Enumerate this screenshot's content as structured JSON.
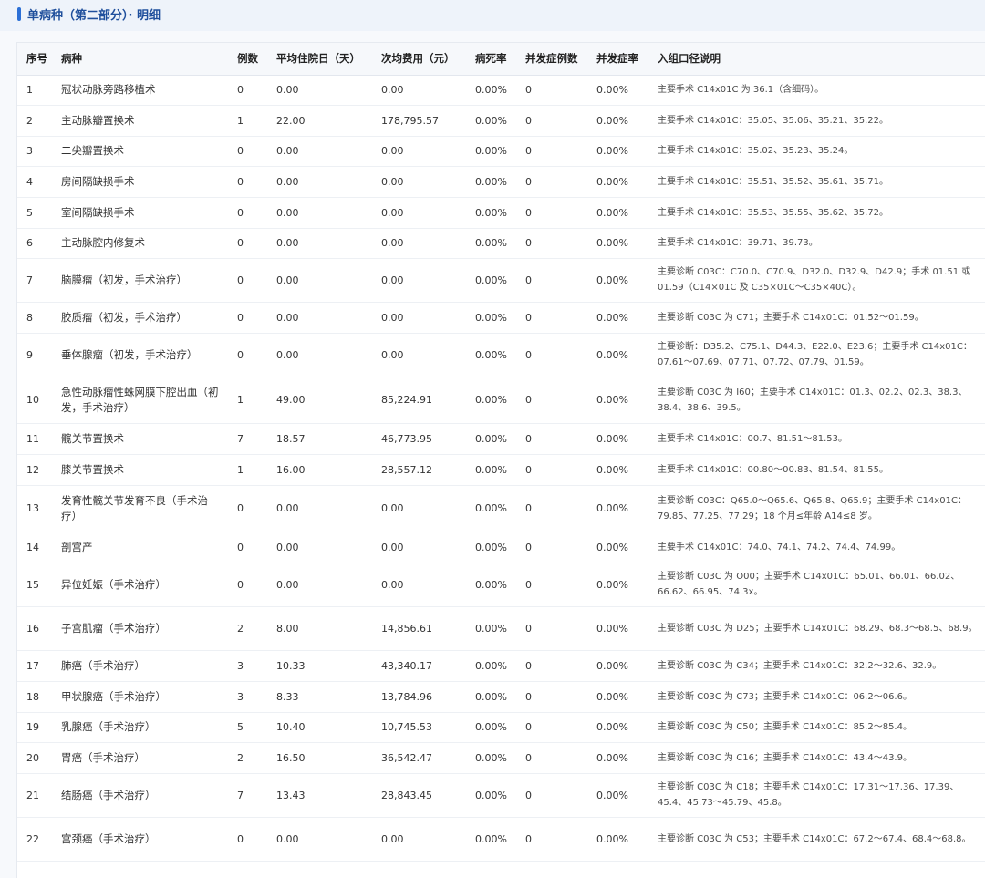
{
  "header": {
    "title": "单病种（第二部分）· 明细"
  },
  "table": {
    "columns": [
      "序号",
      "病种",
      "例数",
      "平均住院日（天）",
      "次均费用（元）",
      "病死率",
      "并发症例数",
      "并发症率",
      "入组口径说明"
    ],
    "rows": [
      {
        "idx": "1",
        "name": "冠状动脉旁路移植术",
        "count": "0",
        "los": "0.00",
        "cost": "0.00",
        "mortality": "0.00%",
        "comp_count": "0",
        "comp_rate": "0.00%",
        "desc": "主要手术 C14x01C 为 36.1（含细码）。"
      },
      {
        "idx": "2",
        "name": "主动脉瓣置换术",
        "count": "1",
        "los": "22.00",
        "cost": "178,795.57",
        "mortality": "0.00%",
        "comp_count": "0",
        "comp_rate": "0.00%",
        "desc": "主要手术 C14x01C：35.05、35.06、35.21、35.22。"
      },
      {
        "idx": "3",
        "name": "二尖瓣置换术",
        "count": "0",
        "los": "0.00",
        "cost": "0.00",
        "mortality": "0.00%",
        "comp_count": "0",
        "comp_rate": "0.00%",
        "desc": "主要手术 C14x01C：35.02、35.23、35.24。"
      },
      {
        "idx": "4",
        "name": "房间隔缺损手术",
        "count": "0",
        "los": "0.00",
        "cost": "0.00",
        "mortality": "0.00%",
        "comp_count": "0",
        "comp_rate": "0.00%",
        "desc": "主要手术 C14x01C：35.51、35.52、35.61、35.71。"
      },
      {
        "idx": "5",
        "name": "室间隔缺损手术",
        "count": "0",
        "los": "0.00",
        "cost": "0.00",
        "mortality": "0.00%",
        "comp_count": "0",
        "comp_rate": "0.00%",
        "desc": "主要手术 C14x01C：35.53、35.55、35.62、35.72。"
      },
      {
        "idx": "6",
        "name": "主动脉腔内修复术",
        "count": "0",
        "los": "0.00",
        "cost": "0.00",
        "mortality": "0.00%",
        "comp_count": "0",
        "comp_rate": "0.00%",
        "desc": "主要手术 C14x01C：39.71、39.73。"
      },
      {
        "idx": "7",
        "name": "脑膜瘤（初发，手术治疗）",
        "count": "0",
        "los": "0.00",
        "cost": "0.00",
        "mortality": "0.00%",
        "comp_count": "0",
        "comp_rate": "0.00%",
        "desc": "主要诊断 C03C：C70.0、C70.9、D32.0、D32.9、D42.9；手术 01.51 或 01.59（C14×01C 及 C35×01C～C35×40C）。"
      },
      {
        "idx": "8",
        "name": "胶质瘤（初发，手术治疗）",
        "count": "0",
        "los": "0.00",
        "cost": "0.00",
        "mortality": "0.00%",
        "comp_count": "0",
        "comp_rate": "0.00%",
        "desc": "主要诊断 C03C 为 C71；主要手术 C14x01C：01.52～01.59。"
      },
      {
        "idx": "9",
        "name": "垂体腺瘤（初发，手术治疗）",
        "count": "0",
        "los": "0.00",
        "cost": "0.00",
        "mortality": "0.00%",
        "comp_count": "0",
        "comp_rate": "0.00%",
        "desc": "主要诊断：D35.2、C75.1、D44.3、E22.0、E23.6；主要手术 C14x01C：07.61～07.69、07.71、07.72、07.79、01.59。"
      },
      {
        "idx": "10",
        "name": "急性动脉瘤性蛛网膜下腔出血（初发，手术治疗）",
        "count": "1",
        "los": "49.00",
        "cost": "85,224.91",
        "mortality": "0.00%",
        "comp_count": "0",
        "comp_rate": "0.00%",
        "desc": "主要诊断 C03C 为 I60；主要手术 C14x01C：01.3、02.2、02.3、38.3、38.4、38.6、39.5。"
      },
      {
        "idx": "11",
        "name": "髋关节置换术",
        "count": "7",
        "los": "18.57",
        "cost": "46,773.95",
        "mortality": "0.00%",
        "comp_count": "0",
        "comp_rate": "0.00%",
        "desc": "主要手术 C14x01C：00.7、81.51～81.53。"
      },
      {
        "idx": "12",
        "name": "膝关节置换术",
        "count": "1",
        "los": "16.00",
        "cost": "28,557.12",
        "mortality": "0.00%",
        "comp_count": "0",
        "comp_rate": "0.00%",
        "desc": "主要手术 C14x01C：00.80～00.83、81.54、81.55。"
      },
      {
        "idx": "13",
        "name": "发育性髋关节发育不良（手术治疗）",
        "count": "0",
        "los": "0.00",
        "cost": "0.00",
        "mortality": "0.00%",
        "comp_count": "0",
        "comp_rate": "0.00%",
        "desc": "主要诊断 C03C：Q65.0～Q65.6、Q65.8、Q65.9；主要手术 C14x01C：79.85、77.25、77.29；18 个月≤年龄 A14≤8 岁。"
      },
      {
        "idx": "14",
        "name": "剖宫产",
        "count": "0",
        "los": "0.00",
        "cost": "0.00",
        "mortality": "0.00%",
        "comp_count": "0",
        "comp_rate": "0.00%",
        "desc": "主要手术 C14x01C：74.0、74.1、74.2、74.4、74.99。"
      },
      {
        "idx": "15",
        "name": "异位妊娠（手术治疗）",
        "count": "0",
        "los": "0.00",
        "cost": "0.00",
        "mortality": "0.00%",
        "comp_count": "0",
        "comp_rate": "0.00%",
        "desc": "主要诊断 C03C 为 O00；主要手术 C14x01C：65.01、66.01、66.02、66.62、66.95、74.3x。"
      },
      {
        "idx": "16",
        "name": "子宫肌瘤（手术治疗）",
        "count": "2",
        "los": "8.00",
        "cost": "14,856.61",
        "mortality": "0.00%",
        "comp_count": "0",
        "comp_rate": "0.00%",
        "desc": "主要诊断 C03C 为 D25；主要手术 C14x01C：68.29、68.3～68.5、68.9。"
      },
      {
        "idx": "17",
        "name": "肺癌（手术治疗）",
        "count": "3",
        "los": "10.33",
        "cost": "43,340.17",
        "mortality": "0.00%",
        "comp_count": "0",
        "comp_rate": "0.00%",
        "desc": "主要诊断 C03C 为 C34；主要手术 C14x01C：32.2～32.6、32.9。"
      },
      {
        "idx": "18",
        "name": "甲状腺癌（手术治疗）",
        "count": "3",
        "los": "8.33",
        "cost": "13,784.96",
        "mortality": "0.00%",
        "comp_count": "0",
        "comp_rate": "0.00%",
        "desc": "主要诊断 C03C 为 C73；主要手术 C14x01C：06.2～06.6。"
      },
      {
        "idx": "19",
        "name": "乳腺癌（手术治疗）",
        "count": "5",
        "los": "10.40",
        "cost": "10,745.53",
        "mortality": "0.00%",
        "comp_count": "0",
        "comp_rate": "0.00%",
        "desc": "主要诊断 C03C 为 C50；主要手术 C14x01C：85.2～85.4。"
      },
      {
        "idx": "20",
        "name": "胃癌（手术治疗）",
        "count": "2",
        "los": "16.50",
        "cost": "36,542.47",
        "mortality": "0.00%",
        "comp_count": "0",
        "comp_rate": "0.00%",
        "desc": "主要诊断 C03C 为 C16；主要手术 C14x01C：43.4～43.9。"
      },
      {
        "idx": "21",
        "name": "结肠癌（手术治疗）",
        "count": "7",
        "los": "13.43",
        "cost": "28,843.45",
        "mortality": "0.00%",
        "comp_count": "0",
        "comp_rate": "0.00%",
        "desc": "主要诊断 C03C 为 C18；主要手术 C14x01C：17.31～17.36、17.39、45.4、45.73～45.79、45.8。"
      },
      {
        "idx": "22",
        "name": "宫颈癌（手术治疗）",
        "count": "0",
        "los": "0.00",
        "cost": "0.00",
        "mortality": "0.00%",
        "comp_count": "0",
        "comp_rate": "0.00%",
        "desc": "主要诊断 C03C 为 C53；主要手术 C14x01C：67.2～67.4、68.4～68.8。"
      }
    ]
  }
}
